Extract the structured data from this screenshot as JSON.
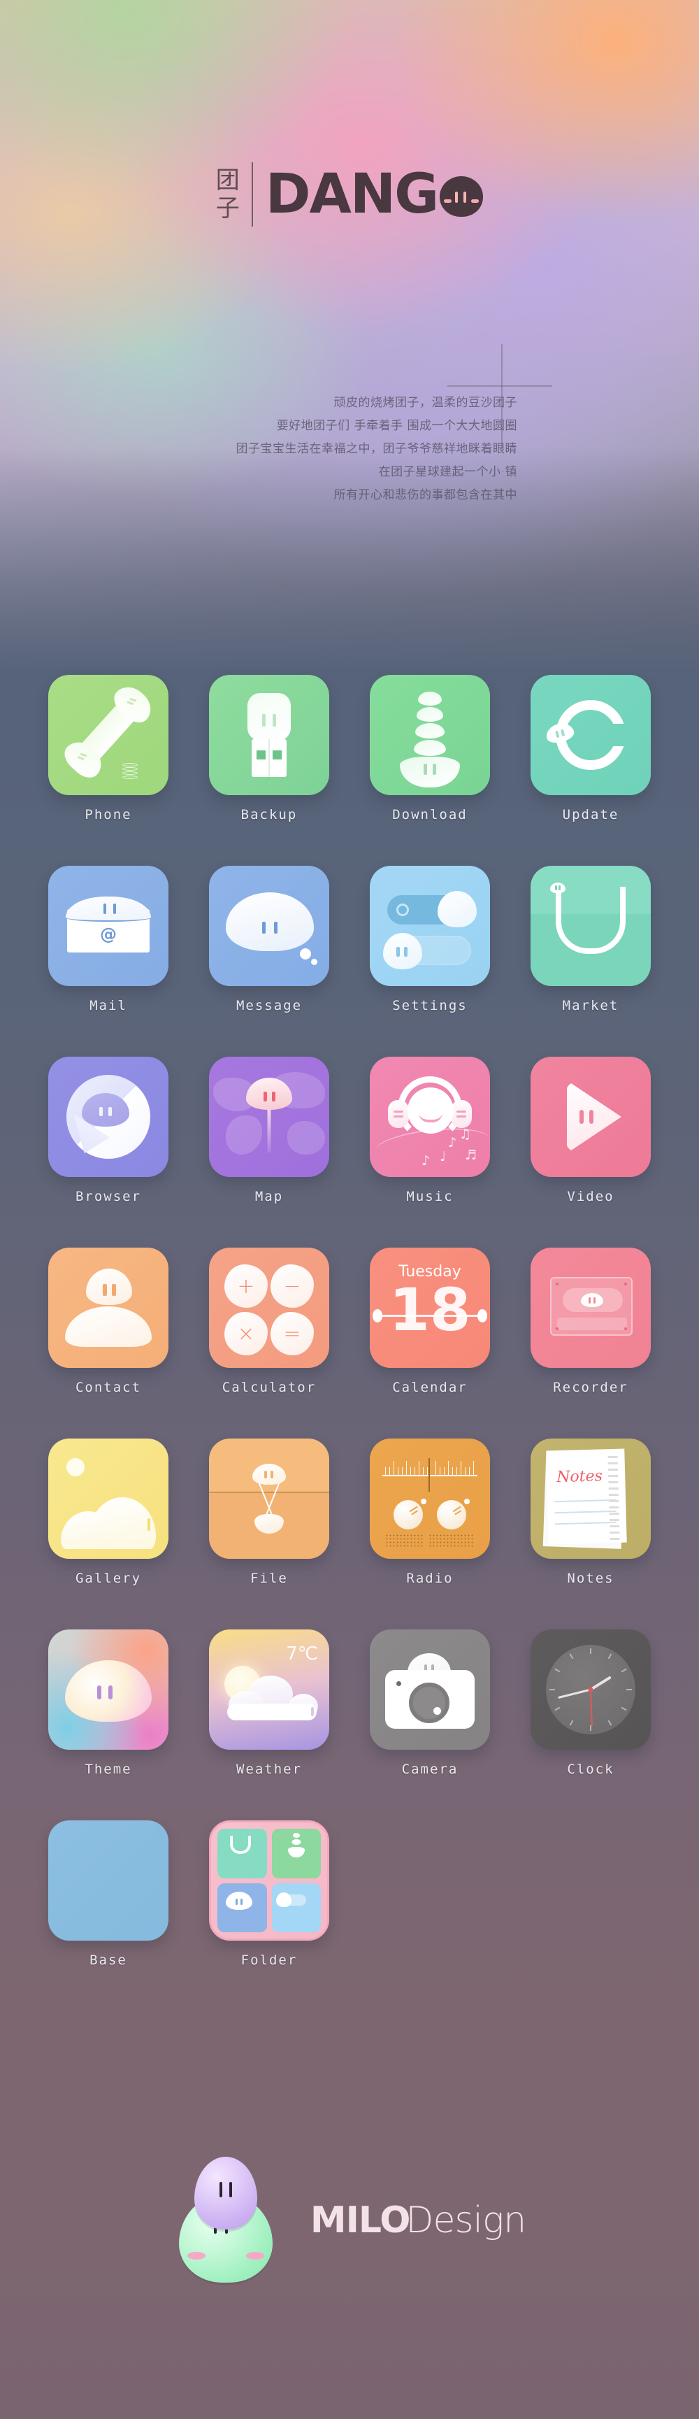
{
  "header": {
    "logo_cn_line1": "团",
    "logo_cn_line2": "子",
    "logo_en": "DANG",
    "logo_o_icon": "dango-face-o"
  },
  "poem": {
    "lines": [
      "顽皮的烧烤团子，温柔的豆沙团子",
      "要好地团子们 手牵着手 围成一个大大地圆圈",
      "团子宝宝生活在幸福之中，团子爷爷慈祥地眯着眼睛",
      "在团子星球建起一个小·镇",
      "所有开心和悲伤的事都包含在其中"
    ]
  },
  "grid": {
    "rows": [
      [
        {
          "label": "Phone",
          "icon": "phone-handset-icon",
          "color": "#a3da80"
        },
        {
          "label": "Backup",
          "icon": "usb-drive-icon",
          "color": "#86d99a"
        },
        {
          "label": "Download",
          "icon": "download-arrow-dango-icon",
          "color": "#7fd897"
        },
        {
          "label": "Update",
          "icon": "refresh-ring-icon",
          "color": "#74d4bc"
        }
      ],
      [
        {
          "label": "Mail",
          "icon": "envelope-at-icon",
          "color": "#8ab0e6"
        },
        {
          "label": "Message",
          "icon": "speech-bubble-dango-icon",
          "color": "#8ab0e6"
        },
        {
          "label": "Settings",
          "icon": "toggle-switches-icon",
          "color": "#9fd4f3"
        },
        {
          "label": "Market",
          "icon": "shopping-bag-icon",
          "color": "#82d9bf"
        }
      ],
      [
        {
          "label": "Browser",
          "icon": "chrome-circle-dango-icon",
          "color": "#8e8be3"
        },
        {
          "label": "Map",
          "icon": "map-pin-dango-icon",
          "color": "#a373de"
        },
        {
          "label": "Music",
          "icon": "headphones-face-icon",
          "color": "#ef84ad"
        },
        {
          "label": "Video",
          "icon": "play-triangle-dango-icon",
          "color": "#ef7f9b"
        }
      ],
      [
        {
          "label": "Contact",
          "icon": "person-dango-icon",
          "color": "#f6b27d"
        },
        {
          "label": "Calculator",
          "icon": "calculator-keys-icon",
          "color": "#f49f83"
        },
        {
          "label": "Calendar",
          "icon": "calendar-date-icon",
          "color": "#f88c7b"
        },
        {
          "label": "Recorder",
          "icon": "cassette-tape-icon",
          "color": "#f18596"
        }
      ],
      [
        {
          "label": "Gallery",
          "icon": "landscape-sun-icon",
          "color": "#f8e485"
        },
        {
          "label": "File",
          "icon": "hourglass-box-icon",
          "color": "#f4b77a"
        },
        {
          "label": "Radio",
          "icon": "radio-tuner-icon",
          "color": "#eaa34b"
        },
        {
          "label": "Notes",
          "icon": "notepad-icon",
          "color": "#bfb16a"
        }
      ],
      [
        {
          "label": "Theme",
          "icon": "gradient-dango-icon",
          "color": "#d9c6d4"
        },
        {
          "label": "Weather",
          "icon": "sun-cloud-icon",
          "color": "#e6c8d8"
        },
        {
          "label": "Camera",
          "icon": "camera-icon",
          "color": "#8a8789"
        },
        {
          "label": "Clock",
          "icon": "analog-clock-icon",
          "color": "#5b5859"
        }
      ],
      [
        {
          "label": "Base",
          "icon": "plain-tile-icon",
          "color": "#89bcdf"
        },
        {
          "label": "Folder",
          "icon": "folder-grid-icon",
          "color": "#f6bcca"
        }
      ]
    ]
  },
  "calendar": {
    "weekday": "Tuesday",
    "day": "18"
  },
  "weather": {
    "temperature": "7℃"
  },
  "notes": {
    "text": "Notes"
  },
  "calculator": {
    "keys": [
      "+",
      "−",
      "×",
      "="
    ]
  },
  "music": {
    "notes": [
      "♪",
      "♫",
      "♩",
      "♪",
      "♬"
    ]
  },
  "footer": {
    "brand_bold": "MILO",
    "brand_thin": "Design",
    "mascot_icon": "dango-mascot-icon"
  },
  "colors": {
    "page_bg": "#7d6670",
    "grid_bg": "#56637a",
    "logo_ink": "#4a3840",
    "label_text": "#e9eaf0"
  }
}
